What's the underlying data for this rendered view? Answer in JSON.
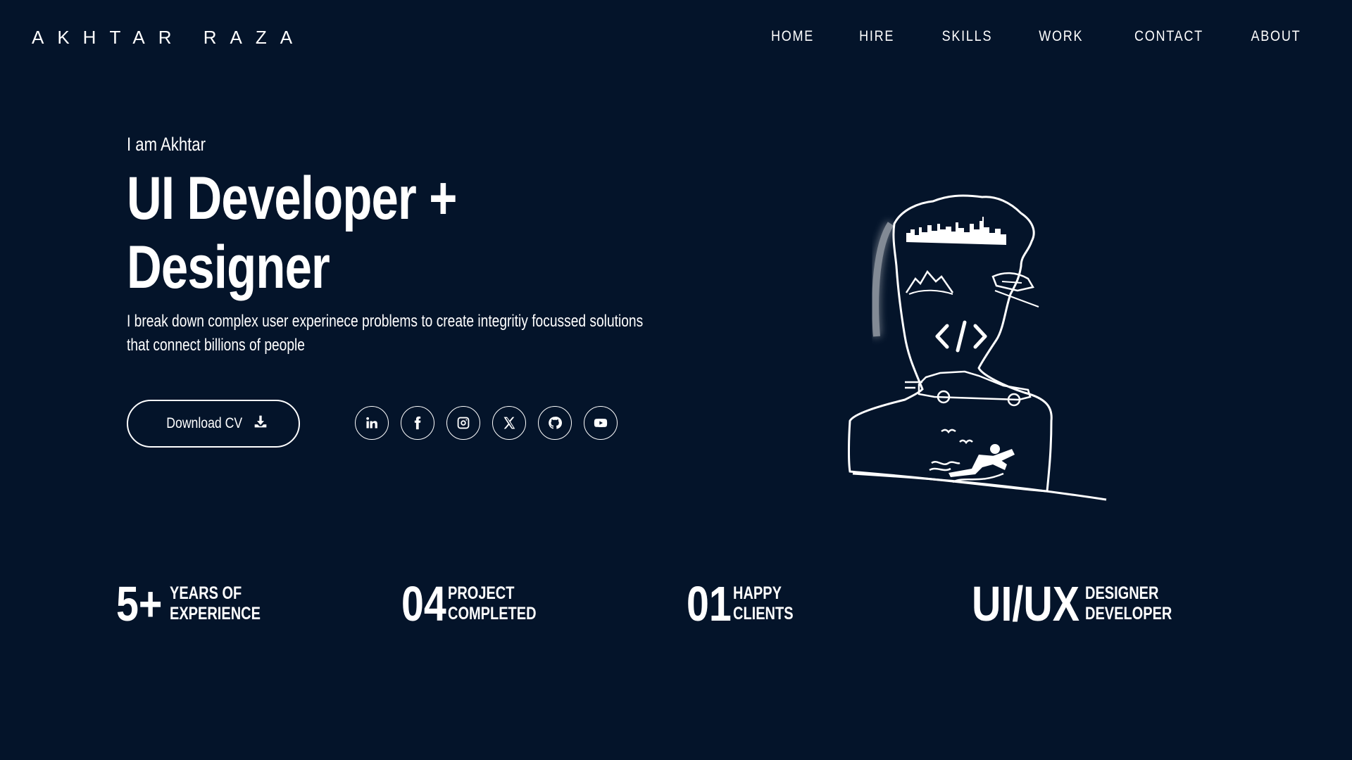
{
  "brand": {
    "name": "AKHTAR RAZA"
  },
  "nav": {
    "items": [
      {
        "label": "HOME"
      },
      {
        "label": "HIRE"
      },
      {
        "label": "SKILLS"
      },
      {
        "label": "WORK"
      },
      {
        "label": "CONTACT"
      },
      {
        "label": "ABOUT"
      }
    ]
  },
  "hero": {
    "intro": "I am Akhtar",
    "headline_line1": "UI Developer +",
    "headline_line2": "Designer",
    "tagline": "I break down complex user experinece problems to create integritiy focussed solutions that connect billions of people",
    "cv_button_label": "Download CV"
  },
  "socials": [
    {
      "name": "linkedin-icon"
    },
    {
      "name": "facebook-icon"
    },
    {
      "name": "instagram-icon"
    },
    {
      "name": "x-twitter-icon"
    },
    {
      "name": "github-icon"
    },
    {
      "name": "youtube-icon"
    }
  ],
  "stats": [
    {
      "value": "5+",
      "line1": "YEARS OF",
      "line2": "EXPERIENCE"
    },
    {
      "value": "04",
      "line1": "PROJECT",
      "line2": "COMPLETED"
    },
    {
      "value": "01",
      "line1": "HAPPY",
      "line2": "CLIENTS"
    },
    {
      "value": "UI/UX",
      "line1": "DESIGNER",
      "line2": "DEVELOPER"
    }
  ],
  "colors": {
    "background": "#04142a",
    "foreground": "#ffffff"
  }
}
